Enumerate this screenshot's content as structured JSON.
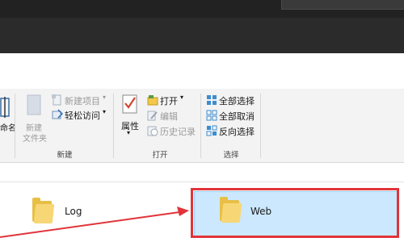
{
  "ribbon": {
    "rename_partial": "命名",
    "new_item": "新建项目",
    "easy_access": "轻松访问",
    "new_folder_line1": "新建",
    "new_folder_line2": "文件夹",
    "new_group_label": "新建",
    "properties": "属性",
    "open": "打开",
    "edit": "编辑",
    "history": "历史记录",
    "open_group_label": "打开",
    "select_all": "全部选择",
    "select_none": "全部取消",
    "invert_selection": "反向选择",
    "select_group_label": "选择"
  },
  "files": [
    {
      "name": "Log",
      "selected": false
    },
    {
      "name": "Web",
      "selected": true
    }
  ],
  "colors": {
    "highlight": "#e0343a",
    "selection": "#cce8ff",
    "folder": "#f7d675"
  },
  "icons": {
    "properties": "checklist-icon",
    "open": "open-icon",
    "edit": "edit-icon",
    "history": "history-icon",
    "select_all": "select-all-icon",
    "select_none": "select-none-icon",
    "invert": "invert-selection-icon",
    "new_folder": "new-folder-icon",
    "new_item": "new-item-icon",
    "easy_access": "easy-access-icon",
    "folder": "folder-icon"
  }
}
